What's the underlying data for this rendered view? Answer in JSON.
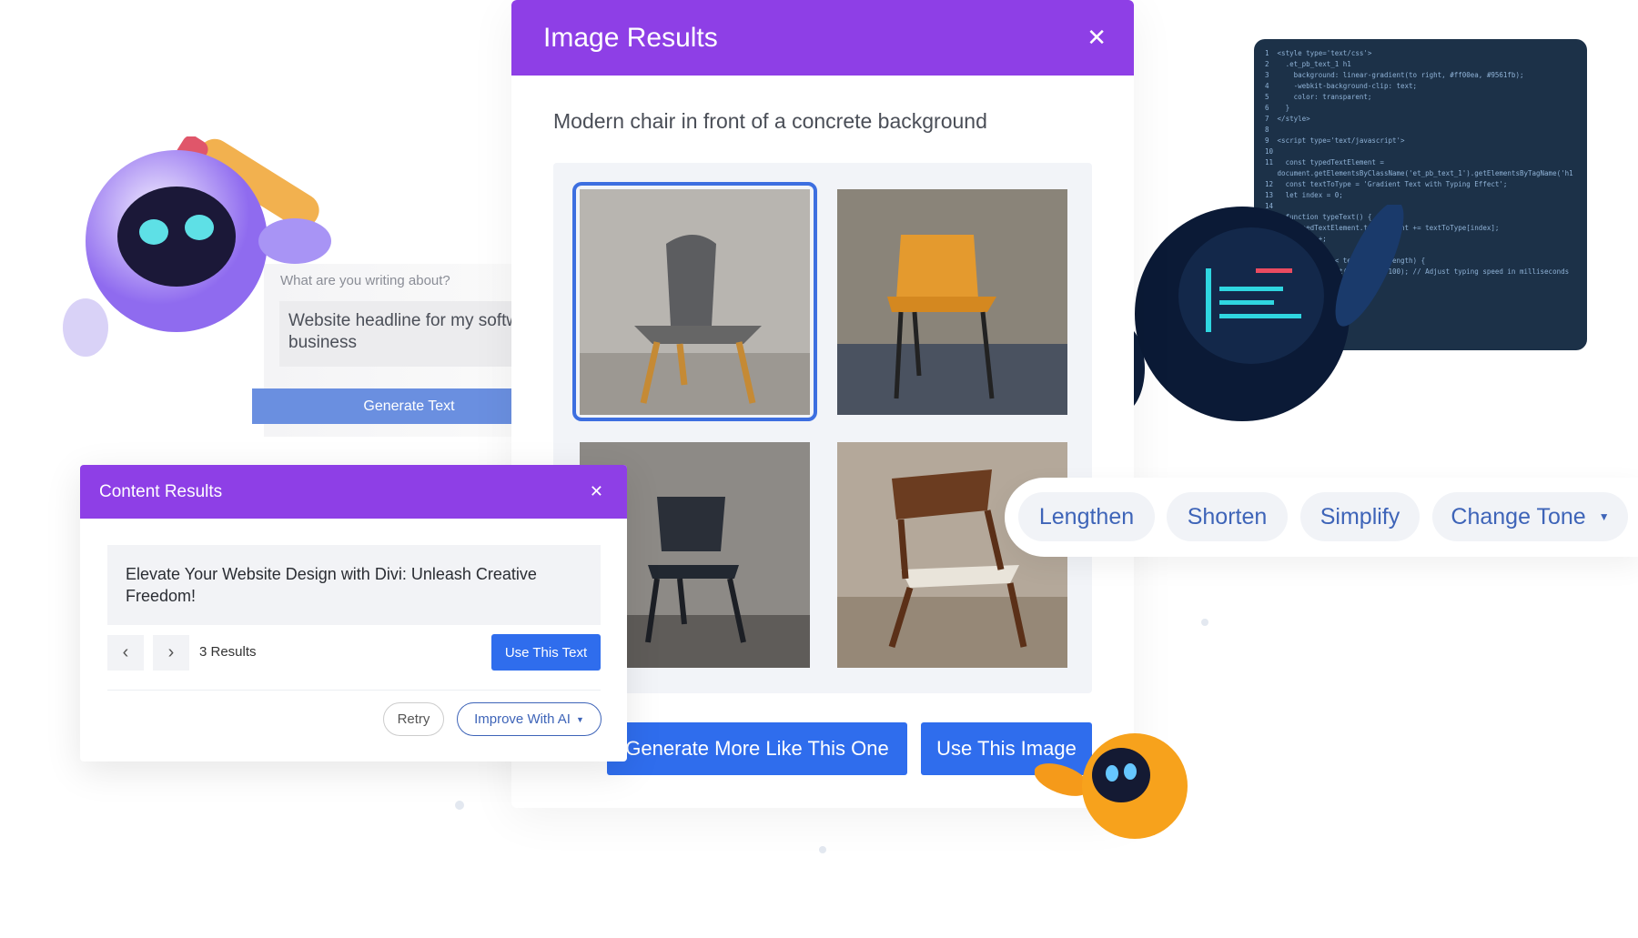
{
  "writer": {
    "label": "What are you writing about?",
    "input_value": "Website headline for my software business",
    "generate_label": "Generate Text"
  },
  "image_results": {
    "title": "Image Results",
    "prompt": "Modern chair in front of a concrete background",
    "images": [
      {
        "alt": "grey chair with wooden legs",
        "selected": true
      },
      {
        "alt": "orange chair with black legs",
        "selected": false
      },
      {
        "alt": "black chair",
        "selected": false
      },
      {
        "alt": "wooden armchair with white seat",
        "selected": false
      }
    ],
    "generate_more_label": "Generate More Like This One",
    "use_image_label": "Use This Image"
  },
  "content_results": {
    "title": "Content Results",
    "result_text": "Elevate Your Website Design with Divi: Unleash Creative Freedom!",
    "count_label": "3 Results",
    "use_text_label": "Use This Text",
    "retry_label": "Retry",
    "improve_label": "Improve With AI"
  },
  "actions": {
    "pills": [
      "Lengthen",
      "Shorten",
      "Simplify",
      "Change Tone"
    ]
  },
  "code": {
    "lines": [
      "1  <style type='text/css'>",
      "2    .et_pb_text_1 h1",
      "3      background: linear-gradient(to right, #ff00ea, #9561fb);",
      "4      -webkit-background-clip: text;",
      "5      color: transparent;",
      "6    }",
      "7  </style>",
      "8",
      "9  <script type='text/javascript'>",
      "10",
      "11   const typedTextElement =",
      "   document.getElementsByClassName('et_pb_text_1').getElementsByTagName('h1",
      "12   const textToType = 'Gradient Text with Typing Effect';",
      "13   let index = 0;",
      "14",
      "15   function typeText() {",
      "16     typedTextElement.textContent += textToType[index];",
      "17     index++;",
      "18",
      "19     if (index < textToType.length) {",
      "20       setTimeout(typeText, 100); // Adjust typing speed in milliseconds"
    ]
  },
  "colors": {
    "header_purple": "#8e3fe6",
    "primary_blue": "#2f6ded",
    "pill_text": "#3e64b8"
  }
}
